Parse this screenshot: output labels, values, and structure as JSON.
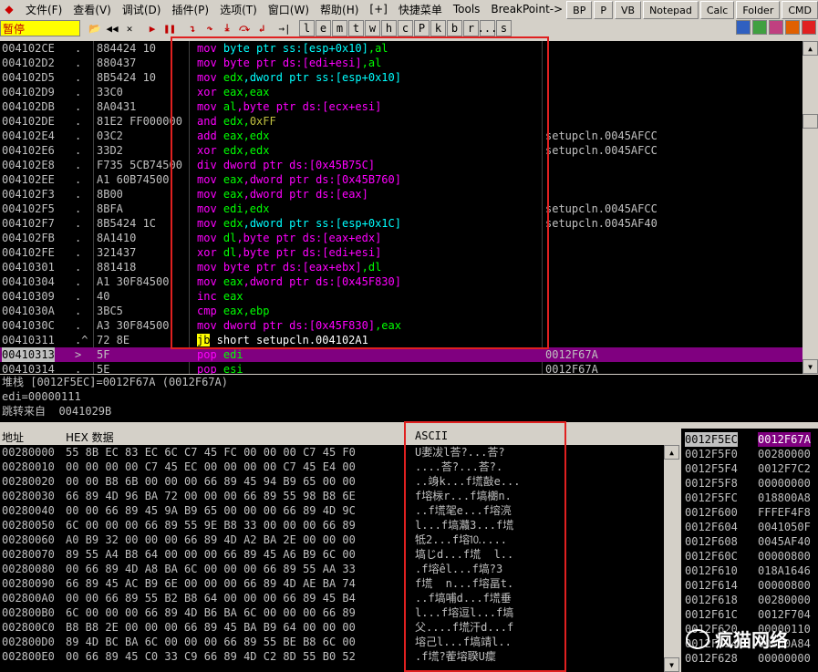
{
  "menu": [
    "文件(F)",
    "查看(V)",
    "调试(D)",
    "插件(P)",
    "选项(T)",
    "窗口(W)",
    "帮助(H)",
    "[+]",
    "快捷菜单",
    "Tools",
    "BreakPoint->"
  ],
  "right_buttons": [
    "BP",
    "P",
    "VB",
    "Notepad",
    "Calc",
    "Folder",
    "CMD"
  ],
  "toolbar": {
    "status": "暂停",
    "letters": [
      "l",
      "e",
      "m",
      "t",
      "w",
      "h",
      "c",
      "P",
      "k",
      "b",
      "r",
      "...",
      "s"
    ]
  },
  "disasm": [
    {
      "addr": "004102CE",
      "mk": ".",
      "hex": "884424 10",
      "asm": [
        [
          "kw",
          "mov "
        ],
        [
          "kw-c",
          "byte ptr ss:[esp+0x10]"
        ],
        [
          "kw-g",
          ",al"
        ]
      ],
      "cmt": ""
    },
    {
      "addr": "004102D2",
      "mk": ".",
      "hex": "880437",
      "asm": [
        [
          "kw",
          "mov "
        ],
        [
          "kw",
          "byte ptr ds:[edi+esi]"
        ],
        [
          "kw-g",
          ",al"
        ]
      ],
      "cmt": ""
    },
    {
      "addr": "004102D5",
      "mk": ".",
      "hex": "8B5424 10",
      "asm": [
        [
          "kw",
          "mov "
        ],
        [
          "kw-g",
          "edx"
        ],
        [
          "kw-c",
          ",dword ptr ss:[esp+0x10]"
        ]
      ],
      "cmt": ""
    },
    {
      "addr": "004102D9",
      "mk": ".",
      "hex": "33C0",
      "asm": [
        [
          "kw",
          "xor "
        ],
        [
          "kw-g",
          "eax,eax"
        ]
      ],
      "cmt": ""
    },
    {
      "addr": "004102DB",
      "mk": ".",
      "hex": "8A0431",
      "asm": [
        [
          "kw",
          "mov "
        ],
        [
          "kw-g",
          "al"
        ],
        [
          "kw",
          ",byte ptr ds:[ecx+esi]"
        ]
      ],
      "cmt": ""
    },
    {
      "addr": "004102DE",
      "mk": ".",
      "hex": "81E2 FF000000",
      "asm": [
        [
          "kw",
          "and "
        ],
        [
          "kw-g",
          "edx,"
        ],
        [
          "numg",
          "0xFF"
        ]
      ],
      "cmt": ""
    },
    {
      "addr": "004102E4",
      "mk": ".",
      "hex": "03C2",
      "asm": [
        [
          "kw",
          "add "
        ],
        [
          "kw-g",
          "eax,edx"
        ]
      ],
      "cmt": "setupcln.0045AFCC"
    },
    {
      "addr": "004102E6",
      "mk": ".",
      "hex": "33D2",
      "asm": [
        [
          "kw",
          "xor "
        ],
        [
          "kw-g",
          "edx,edx"
        ]
      ],
      "cmt": "setupcln.0045AFCC"
    },
    {
      "addr": "004102E8",
      "mk": ".",
      "hex": "F735 5CB74500",
      "asm": [
        [
          "kw",
          "div "
        ],
        [
          "kw",
          "dword ptr ds:[0x45B75C]"
        ]
      ],
      "cmt": ""
    },
    {
      "addr": "004102EE",
      "mk": ".",
      "hex": "A1 60B74500",
      "asm": [
        [
          "kw",
          "mov "
        ],
        [
          "kw-g",
          "eax"
        ],
        [
          "kw",
          ",dword ptr ds:[0x45B760]"
        ]
      ],
      "cmt": ""
    },
    {
      "addr": "004102F3",
      "mk": ".",
      "hex": "8B00",
      "asm": [
        [
          "kw",
          "mov "
        ],
        [
          "kw-g",
          "eax"
        ],
        [
          "kw",
          ",dword ptr ds:[eax]"
        ]
      ],
      "cmt": ""
    },
    {
      "addr": "004102F5",
      "mk": ".",
      "hex": "8BFA",
      "asm": [
        [
          "kw",
          "mov "
        ],
        [
          "kw-g",
          "edi,edx"
        ]
      ],
      "cmt": "setupcln.0045AFCC"
    },
    {
      "addr": "004102F7",
      "mk": ".",
      "hex": "8B5424 1C",
      "asm": [
        [
          "kw",
          "mov "
        ],
        [
          "kw-g",
          "edx"
        ],
        [
          "kw-c",
          ",dword ptr ss:[esp+0x1C]"
        ]
      ],
      "cmt": "setupcln.0045AF40"
    },
    {
      "addr": "004102FB",
      "mk": ".",
      "hex": "8A1410",
      "asm": [
        [
          "kw",
          "mov "
        ],
        [
          "kw-g",
          "dl"
        ],
        [
          "kw",
          ",byte ptr ds:[eax+edx]"
        ]
      ],
      "cmt": ""
    },
    {
      "addr": "004102FE",
      "mk": ".",
      "hex": "321437",
      "asm": [
        [
          "kw",
          "xor "
        ],
        [
          "kw-g",
          "dl"
        ],
        [
          "kw",
          ",byte ptr ds:[edi+esi]"
        ]
      ],
      "cmt": ""
    },
    {
      "addr": "00410301",
      "mk": ".",
      "hex": "881418",
      "asm": [
        [
          "kw",
          "mov "
        ],
        [
          "kw",
          "byte ptr ds:[eax+ebx]"
        ],
        [
          "kw-g",
          ",dl"
        ]
      ],
      "cmt": ""
    },
    {
      "addr": "00410304",
      "mk": ".",
      "hex": "A1 30F84500",
      "asm": [
        [
          "kw",
          "mov "
        ],
        [
          "kw-g",
          "eax"
        ],
        [
          "kw",
          ",dword ptr ds:[0x45F830]"
        ]
      ],
      "cmt": ""
    },
    {
      "addr": "00410309",
      "mk": ".",
      "hex": "40",
      "asm": [
        [
          "kw",
          "inc "
        ],
        [
          "kw-g",
          "eax"
        ]
      ],
      "cmt": ""
    },
    {
      "addr": "0041030A",
      "mk": ".",
      "hex": "3BC5",
      "asm": [
        [
          "kw",
          "cmp "
        ],
        [
          "kw-g",
          "eax,ebp"
        ]
      ],
      "cmt": ""
    },
    {
      "addr": "0041030C",
      "mk": ".",
      "hex": "A3 30F84500",
      "asm": [
        [
          "kw",
          "mov "
        ],
        [
          "kw",
          "dword ptr ds:[0x45F830]"
        ],
        [
          "kw-g",
          ",eax"
        ]
      ],
      "cmt": ""
    },
    {
      "addr": "00410311",
      "mk": ".^",
      "hex": "72 8E",
      "asm": [
        [
          "jb",
          "jb"
        ],
        [
          "plain",
          " short setupcln.004102A1"
        ]
      ],
      "cmt": ""
    },
    {
      "addr": "00410313",
      "mk": ">",
      "hex": "5F",
      "asm": [
        [
          "kw",
          "pop "
        ],
        [
          "kw-g",
          "edi"
        ]
      ],
      "cmt": "0012F67A",
      "sel": true
    },
    {
      "addr": "00410314",
      "mk": ".",
      "hex": "5E",
      "asm": [
        [
          "kw",
          "pop "
        ],
        [
          "kw-g",
          "esi"
        ]
      ],
      "cmt": "0012F67A"
    }
  ],
  "info": [
    "堆栈 [0012F5EC]=0012F67A (0012F67A)",
    "edi=00000111",
    "跳转来自  0041029B"
  ],
  "dump_header": {
    "addr": "地址",
    "hex": "HEX 数据",
    "ascii": "ASCII"
  },
  "dump": [
    {
      "a": "00280000",
      "h": "55 8B EC 83 EC 6C C7 45 FC 00 00 00 C7 45 F0",
      "s": "U嬱冹l荅?...荅?"
    },
    {
      "a": "00280010",
      "h": "00 00 00 00 C7 45 EC 00 00 00 00 C7 45 E4 00",
      "s": "....荅?...荅?."
    },
    {
      "a": "00280020",
      "h": "00 00 B8 6B 00 00 00 66 89 45 94 B9 65 00 00",
      "s": "..竧k...f塃敼e..."
    },
    {
      "a": "00280030",
      "h": "66 89 4D 96 BA 72 00 00 00 66 89 55 98 B8 6E",
      "s": "f塎柡r...f塙樃n."
    },
    {
      "a": "00280040",
      "h": "00 00 66 89 45 9A B9 65 00 00 00 66 89 4D 9C",
      "s": "..f塃毠e...f塎湸"
    },
    {
      "a": "00280050",
      "h": "6C 00 00 00 66 89 55 9E B8 33 00 00 00 66 89",
      "s": "l...f塙灨3...f塃"
    },
    {
      "a": "00280060",
      "h": "A0 B9 32 00 00 00 66 89 4D A2 BA 2E 00 00 00",
      "s": "牴2...f塎⒑...."
    },
    {
      "a": "00280070",
      "h": "89 55 A4 B8 64 00 00 00 66 89 45 A6 B9 6C 00",
      "s": "塙じd...f塃  l.."
    },
    {
      "a": "00280080",
      "h": "00 66 89 4D A8 BA 6C 00 00 00 66 89 55 AA 33",
      "s": ".f塎êl...f塙?3"
    },
    {
      "a": "00280090",
      "h": "66 89 45 AC B9 6E 00 00 00 66 89 4D AE BA 74",
      "s": "f塃  n...f塎畐t."
    },
    {
      "a": "002800A0",
      "h": "00 00 66 89 55 B2 B8 64 00 00 00 66 89 45 B4",
      "s": "..f塙哺d...f塃垂"
    },
    {
      "a": "002800B0",
      "h": "6C 00 00 00 66 89 4D B6 BA 6C 00 00 00 66 89",
      "s": "l...f塎逗l...f塙"
    },
    {
      "a": "002800C0",
      "h": "B8 B8 2E 00 00 00 66 89 45 BA B9 64 00 00 00",
      "s": "父....f塃汗d...f"
    },
    {
      "a": "002800D0",
      "h": "89 4D BC BA 6C 00 00 00 66 89 55 BE B8 6C 00",
      "s": "塎己l...f塙靖l.."
    },
    {
      "a": "002800E0",
      "h": "00 66 89 45 C0 33 C9 66 89 4D C2 8D 55 B0 52",
      "s": ".f塃?蒮塎聧U癛"
    }
  ],
  "stack": [
    {
      "a": "0012F5EC",
      "v": "0012F67A",
      "sel": true
    },
    {
      "a": "0012F5F0",
      "v": "00280000"
    },
    {
      "a": "0012F5F4",
      "v": "0012F7C2"
    },
    {
      "a": "0012F5F8",
      "v": "00000000"
    },
    {
      "a": "0012F5FC",
      "v": "018800A8"
    },
    {
      "a": "0012F600",
      "v": "FFFEF4F8"
    },
    {
      "a": "0012F604",
      "v": "0041050F"
    },
    {
      "a": "0012F608",
      "v": "0045AF40"
    },
    {
      "a": "0012F60C",
      "v": "00000800"
    },
    {
      "a": "0012F610",
      "v": "018A1646"
    },
    {
      "a": "0012F614",
      "v": "00000800"
    },
    {
      "a": "0012F618",
      "v": "00280000"
    },
    {
      "a": "0012F61C",
      "v": "0012F704"
    },
    {
      "a": "0012F620",
      "v": "00000110"
    },
    {
      "a": "0012F624",
      "v": "00000A84"
    },
    {
      "a": "0012F628",
      "v": "00000000"
    }
  ],
  "watermark": "疯猫网络"
}
